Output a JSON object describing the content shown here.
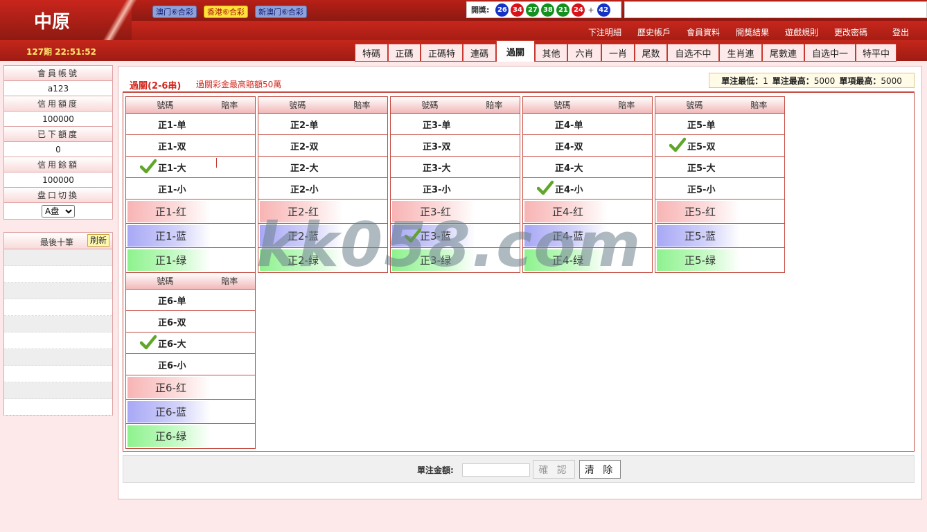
{
  "header": {
    "logo_text": "中原",
    "period": "127期 22:51:52",
    "lottery_types": [
      {
        "label": "澳门⑥合彩",
        "active": false
      },
      {
        "label": "香港⑥合彩",
        "active": true
      },
      {
        "label": "新澳门⑥合彩",
        "active": false
      }
    ],
    "draw": {
      "label": "開獎:",
      "balls": [
        {
          "num": "26",
          "color": "blue"
        },
        {
          "num": "34",
          "color": "red"
        },
        {
          "num": "27",
          "color": "green"
        },
        {
          "num": "38",
          "color": "green"
        },
        {
          "num": "21",
          "color": "green"
        },
        {
          "num": "24",
          "color": "red"
        }
      ],
      "plus": "+",
      "special": {
        "num": "42",
        "color": "blue"
      }
    },
    "top_links": [
      "下注明細",
      "歷史帳戶",
      "會員資料",
      "開獎結果",
      "遊戲規則",
      "更改密碼",
      "登出"
    ],
    "tabs": [
      "特碼",
      "正碼",
      "正碼特",
      "連碼",
      "過關",
      "其他",
      "六肖",
      "一肖",
      "尾数",
      "自选不中",
      "生肖連",
      "尾數連",
      "自选中一",
      "特平中"
    ],
    "active_tab": "過關"
  },
  "sidebar": {
    "account_label": "會員帳號",
    "account_value": "a123",
    "credit_label": "信用額度",
    "credit_value": "100000",
    "placed_label": "已下額度",
    "placed_value": "0",
    "balance_label": "信用餘額",
    "balance_value": "100000",
    "plate_label": "盘口切換",
    "plate_value": "A盘",
    "recent_title": "最後十筆",
    "refresh_label": "刷新"
  },
  "main": {
    "title": "過關(2-6串)",
    "subtitle": "過關彩金最高賠額50萬",
    "limits": {
      "min_label": "單注最低：",
      "min_value": "1",
      "max_label": "單注最高：",
      "max_value": "5000",
      "item_max_label": "單項最高：",
      "item_max_value": "5000"
    },
    "col_code": "號碼",
    "col_odds": "賠率",
    "tables": [
      {
        "rows": [
          "正1-单",
          "正1-双",
          "正1-大",
          "正1-小",
          "正1-红",
          "正1-蓝",
          "正1-绿"
        ],
        "checked": [
          2
        ]
      },
      {
        "rows": [
          "正2-单",
          "正2-双",
          "正2-大",
          "正2-小",
          "正2-红",
          "正2-蓝",
          "正2-绿"
        ],
        "checked": []
      },
      {
        "rows": [
          "正3-单",
          "正3-双",
          "正3-大",
          "正3-小",
          "正3-红",
          "正3-蓝",
          "正3-绿"
        ],
        "checked": [
          5
        ]
      },
      {
        "rows": [
          "正4-单",
          "正4-双",
          "正4-大",
          "正4-小",
          "正4-红",
          "正4-蓝",
          "正4-绿"
        ],
        "checked": [
          3
        ]
      },
      {
        "rows": [
          "正5-单",
          "正5-双",
          "正5-大",
          "正5-小",
          "正5-红",
          "正5-蓝",
          "正5-绿"
        ],
        "checked": [
          1
        ]
      },
      {
        "rows": [
          "正6-单",
          "正6-双",
          "正6-大",
          "正6-小",
          "正6-红",
          "正6-蓝",
          "正6-绿"
        ],
        "checked": [
          2
        ]
      }
    ],
    "amount_label": "單注金額:",
    "confirm_label": "確 認",
    "clear_label": "清 除"
  },
  "watermark": "kk058.com",
  "colors": {
    "header_red": "#d4261c",
    "ball_blue": "#1532c7",
    "ball_red": "#d9121a",
    "ball_green": "#14901e",
    "check_green": "#5fa62a"
  },
  "icons": {
    "check": "check-icon",
    "select_caret": "chevron-down-icon"
  }
}
